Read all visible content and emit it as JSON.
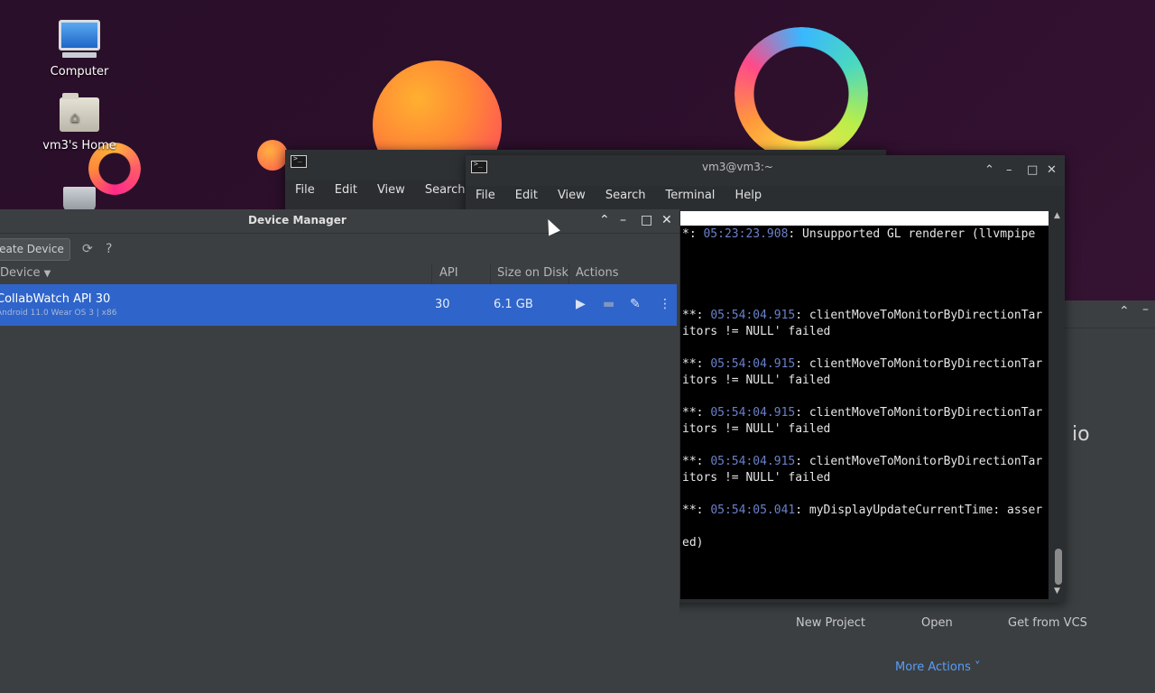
{
  "desktop": {
    "icons": [
      {
        "label": "Computer"
      },
      {
        "label": "vm3's Home"
      }
    ]
  },
  "back_terminal": {
    "menu": [
      "File",
      "Edit",
      "View",
      "Search"
    ]
  },
  "front_terminal": {
    "title": "vm3@vm3:~",
    "menu": [
      "File",
      "Edit",
      "View",
      "Search",
      "Terminal",
      "Help"
    ],
    "lines": [
      {
        "prefix": "*: ",
        "ts": "05:23:23.908",
        "msg": ": Unsupported GL renderer (llvmpipe"
      },
      {
        "prefix": "**: ",
        "ts": "05:54:04.915",
        "msg": ": clientMoveToMonitorByDirectionTar"
      },
      {
        "prefix": "",
        "ts": "",
        "msg": "itors != NULL' failed"
      },
      {
        "prefix": "**: ",
        "ts": "05:54:04.915",
        "msg": ": clientMoveToMonitorByDirectionTar"
      },
      {
        "prefix": "",
        "ts": "",
        "msg": "itors != NULL' failed"
      },
      {
        "prefix": "**: ",
        "ts": "05:54:04.915",
        "msg": ": clientMoveToMonitorByDirectionTar"
      },
      {
        "prefix": "",
        "ts": "",
        "msg": "itors != NULL' failed"
      },
      {
        "prefix": "**: ",
        "ts": "05:54:04.915",
        "msg": ": clientMoveToMonitorByDirectionTar"
      },
      {
        "prefix": "",
        "ts": "",
        "msg": "itors != NULL' failed"
      },
      {
        "prefix": "**: ",
        "ts": "05:54:05.041",
        "msg": ": myDisplayUpdateCurrentTime: asser"
      },
      {
        "prefix": "",
        "ts": "",
        "msg": "ed)"
      }
    ]
  },
  "studio": {
    "title_fragment": "io",
    "actions": [
      "New Project",
      "Open",
      "Get from VCS"
    ],
    "more_actions": "More Actions ˅"
  },
  "device_manager": {
    "title": "Device Manager",
    "create_button": "eate Device",
    "columns": {
      "device": "Device",
      "api": "API",
      "size": "Size on Disk",
      "actions": "Actions"
    },
    "devices": [
      {
        "name": "CollabWatch API 30",
        "subtitle": "Android 11.0 Wear OS 3 | x86",
        "api": "30",
        "size": "6.1 GB"
      }
    ]
  }
}
